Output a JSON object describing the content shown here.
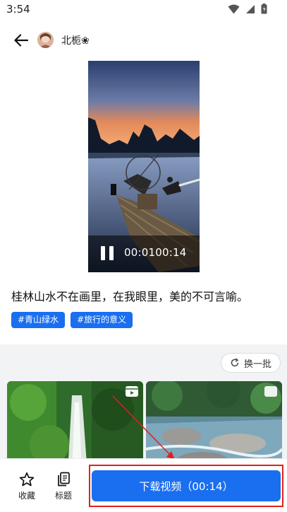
{
  "status": {
    "time": "3:54"
  },
  "header": {
    "username": "北栀❀"
  },
  "video": {
    "time_readout": "00:0100:14"
  },
  "post": {
    "caption": "桂林山水不在画里，在我眼里，美的不可言喻。",
    "tags": [
      "#青山绿水",
      "#旅行的意义"
    ]
  },
  "recommendations": {
    "refresh_label": "换一批"
  },
  "bottom_bar": {
    "favorite_label": "收藏",
    "title_label": "标题",
    "download_label": "下载视频（00:14）"
  },
  "colors": {
    "accent": "#1a6ef0",
    "annotation": "#e02020"
  }
}
